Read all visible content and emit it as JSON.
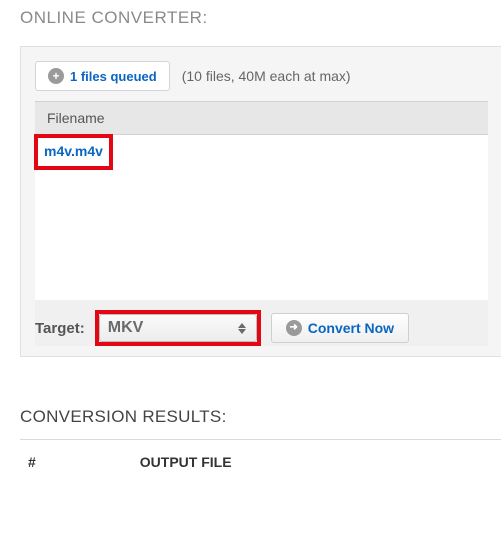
{
  "converter": {
    "title": "ONLINE CONVERTER:",
    "queue_button": "1 files queued",
    "queue_note": "(10 files, 40M each at max)",
    "table": {
      "header_filename": "Filename",
      "rows": [
        {
          "filename": "m4v.m4v"
        }
      ]
    },
    "target_label": "Target:",
    "target_value": "MKV",
    "convert_button": "Convert Now"
  },
  "results": {
    "title": "CONVERSION RESULTS:",
    "col_index": "#",
    "col_output": "OUTPUT FILE"
  },
  "highlight_color": "#e30613"
}
